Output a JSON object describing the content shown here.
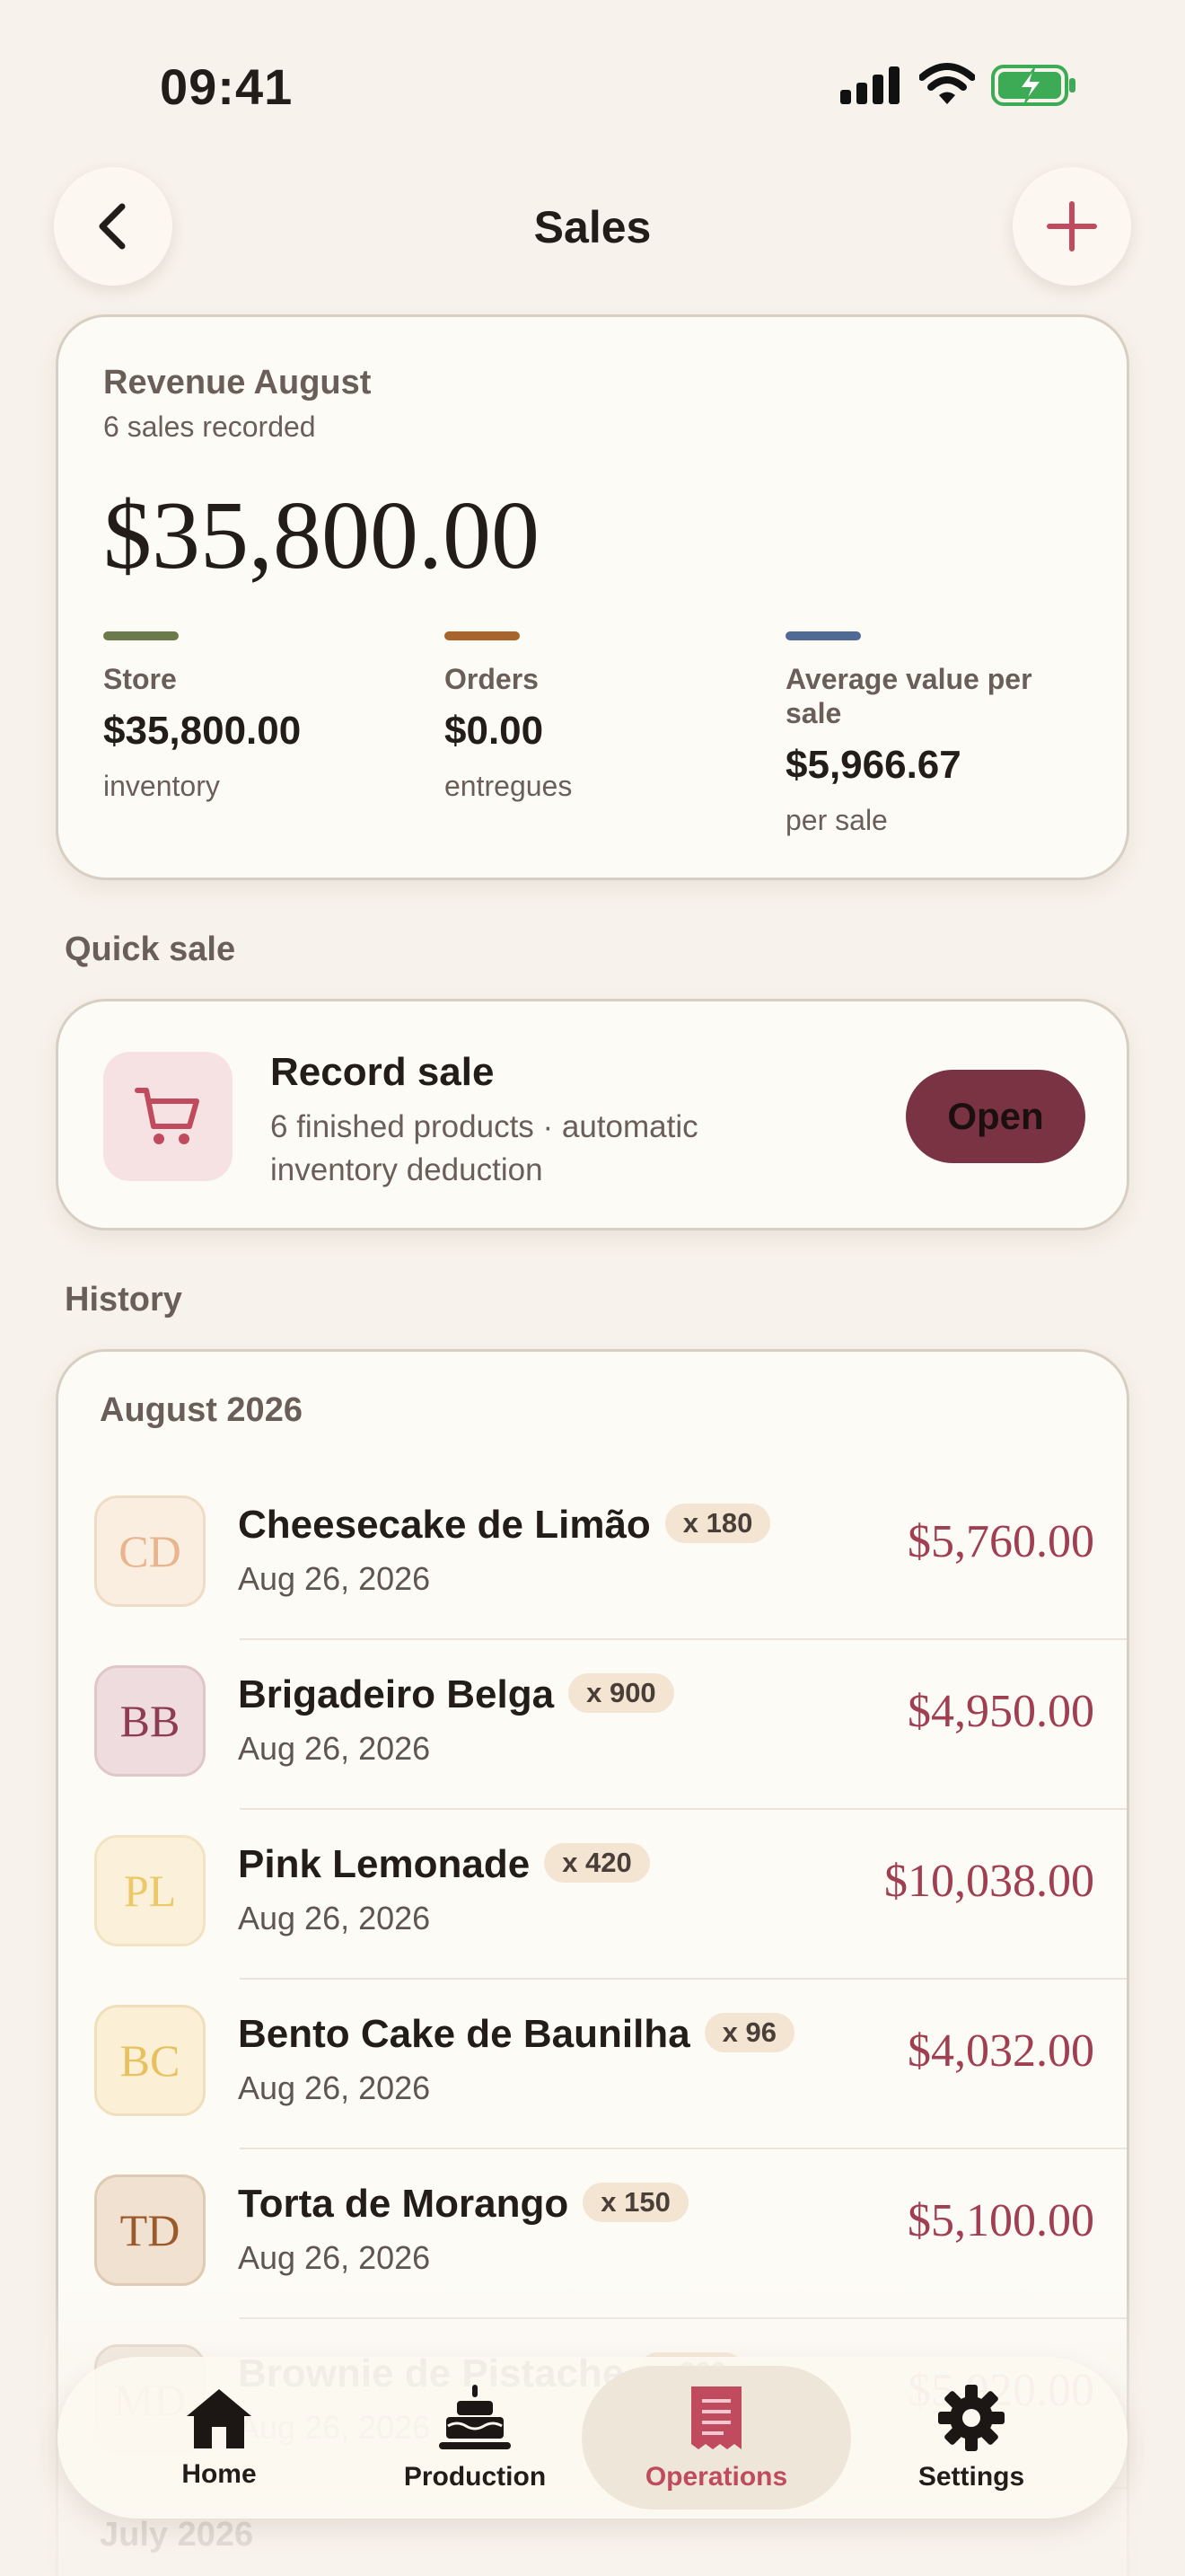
{
  "status": {
    "time": "09:41"
  },
  "nav": {
    "title": "Sales"
  },
  "revenue": {
    "title": "Revenue August",
    "subtitle": "6 sales recorded",
    "amount": "$35,800.00",
    "stats": [
      {
        "label": "Store",
        "value": "$35,800.00",
        "note": "inventory",
        "color": "#6b7a4a"
      },
      {
        "label": "Orders",
        "value": "$0.00",
        "note": "entregues",
        "color": "#a8642a"
      },
      {
        "label": "Average value per sale",
        "value": "$5,966.67",
        "note": "per sale",
        "color": "#4f6b95"
      }
    ]
  },
  "quick_sale": {
    "section_label": "Quick sale",
    "title": "Record sale",
    "description": "6 finished products · automatic inventory deduction",
    "button": "Open"
  },
  "history": {
    "section_label": "History",
    "months": [
      {
        "label": "August 2026",
        "items": [
          {
            "initials": "CD",
            "name": "Cheesecake de Limão",
            "qty": "x 180",
            "date": "Aug 26, 2026",
            "amount": "$5,760.00",
            "avatar_bg": "#faeee1",
            "avatar_border": "#efdcc4",
            "avatar_text": "#e8b58e"
          },
          {
            "initials": "BB",
            "name": "Brigadeiro Belga",
            "qty": "x 900",
            "date": "Aug 26, 2026",
            "amount": "$4,950.00",
            "avatar_bg": "#efdcdf",
            "avatar_border": "#dfc6c8",
            "avatar_text": "#8e3b54"
          },
          {
            "initials": "PL",
            "name": "Pink Lemonade",
            "qty": "x 420",
            "date": "Aug 26, 2026",
            "amount": "$10,038.00",
            "avatar_bg": "#fbf1db",
            "avatar_border": "#f2e3c2",
            "avatar_text": "#ecc866"
          },
          {
            "initials": "BC",
            "name": "Bento Cake de Baunilha",
            "qty": "x 96",
            "date": "Aug 26, 2026",
            "amount": "$4,032.00",
            "avatar_bg": "#fbefd5",
            "avatar_border": "#f0dfbd",
            "avatar_text": "#e8c15f"
          },
          {
            "initials": "TD",
            "name": "Torta de Morango",
            "qty": "x 150",
            "date": "Aug 26, 2026",
            "amount": "$5,100.00",
            "avatar_bg": "#f0e1d0",
            "avatar_border": "#dfcab2",
            "avatar_text": "#9b5a2c"
          },
          {
            "initials": "MD",
            "name": "Brownie de Pistache",
            "qty": "x 300",
            "date": "Aug 26, 2026",
            "amount": "$5,920.00",
            "avatar_bg": "#f0e6db",
            "avatar_border": "#e0d3c2",
            "avatar_text": "#b98a62"
          }
        ]
      },
      {
        "label": "July 2026",
        "items": []
      }
    ]
  },
  "tabs": [
    {
      "label": "Home",
      "icon": "house-icon",
      "active": false
    },
    {
      "label": "Production",
      "icon": "cake-icon",
      "active": false
    },
    {
      "label": "Operations",
      "icon": "receipt-icon",
      "active": true
    },
    {
      "label": "Settings",
      "icon": "gear-icon",
      "active": false
    }
  ],
  "colors": {
    "accent": "#c04a5e",
    "open_button": "#7a3342",
    "amount": "#a03e52"
  }
}
